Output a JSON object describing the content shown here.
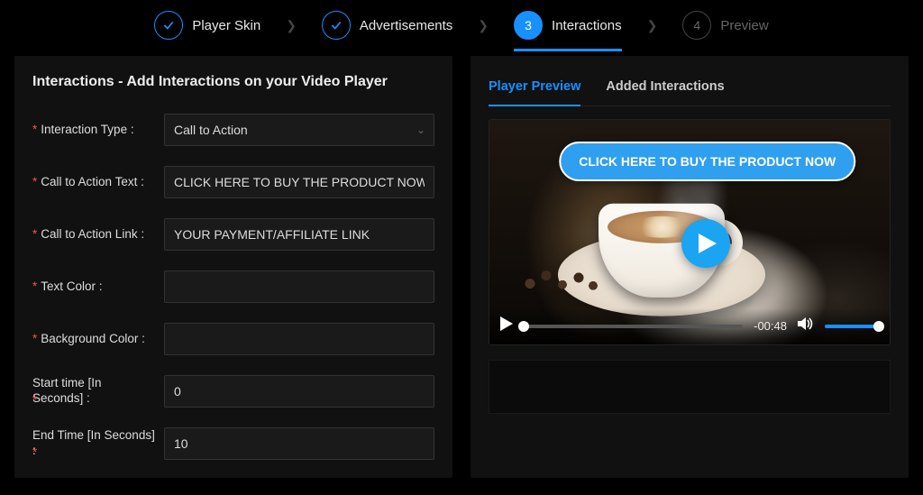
{
  "stepper": {
    "steps": [
      {
        "label": "Player Skin",
        "indicator": "check"
      },
      {
        "label": "Advertisements",
        "indicator": "check"
      },
      {
        "label": "Interactions",
        "indicator": "3"
      },
      {
        "label": "Preview",
        "indicator": "4"
      }
    ]
  },
  "form": {
    "title": "Interactions - Add Interactions on your Video Player",
    "interaction_type_label": "Interaction Type",
    "interaction_type_value": "Call to Action",
    "cta_text_label": "Call to Action Text",
    "cta_text_value": "CLICK HERE TO BUY THE PRODUCT NOW",
    "cta_link_label": "Call to Action Link",
    "cta_link_value": "YOUR PAYMENT/AFFILIATE LINK",
    "text_color_label": "Text Color",
    "text_color_value": "",
    "bg_color_label": "Background Color",
    "bg_color_value": "",
    "start_time_label": "Start time [In Seconds]",
    "start_time_value": "0",
    "end_time_label": "End Time [In Seconds]",
    "end_time_value": "10"
  },
  "preview": {
    "tabs": {
      "player_preview": "Player Preview",
      "added": "Added Interactions"
    },
    "cta_overlay": "CLICK HERE TO BUY THE PRODUCT NOW",
    "time_remaining": "-00:48"
  }
}
